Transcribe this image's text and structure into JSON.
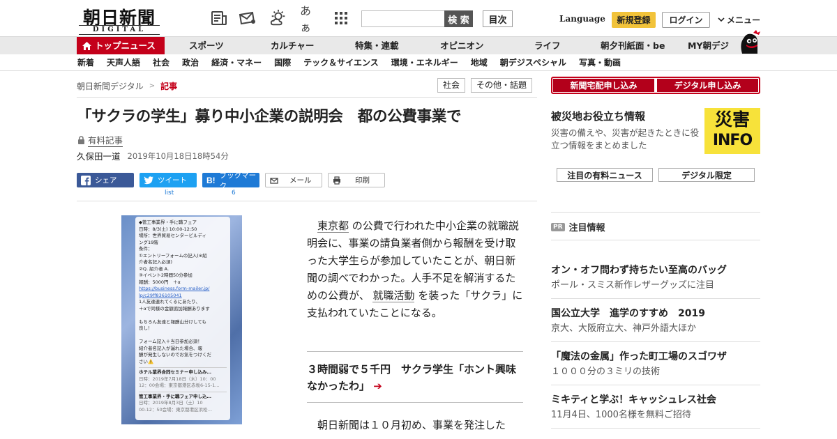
{
  "header": {
    "logo_main": "朝日新聞",
    "logo_sub": "DIGITAL",
    "search_placeholder": "",
    "search_label": "検 索",
    "toc_label": "目次",
    "language_label": "Language",
    "register_label": "新規登録",
    "login_label": "ログイン",
    "menu_label": "メニュー",
    "icons": [
      "paper-icon",
      "mail-icon",
      "weather-icon",
      "font-size-icon",
      "grid-icon"
    ],
    "font_icon_text": "あぁ"
  },
  "nav1": {
    "top_news": "トップニュース",
    "items": [
      "スポーツ",
      "カルチャー",
      "特集・連載",
      "オピニオン",
      "ライフ",
      "朝夕刊紙面・be",
      "MY朝デジ"
    ]
  },
  "nav2": {
    "items": [
      "新着",
      "天声人語",
      "社会",
      "政治",
      "経済・マネー",
      "国際",
      "テック＆サイエンス",
      "環境・エネルギー",
      "地域",
      "朝デジスペシャル",
      "写真・動画"
    ]
  },
  "breadcrumb": {
    "home": "朝日新聞デジタル",
    "sep": ">",
    "current": "記事"
  },
  "tags": [
    "社会",
    "その他・話題"
  ],
  "article": {
    "title": "「サクラの学生」募り中小企業の説明会　都の公費事業で",
    "paid_label": "有料記事",
    "author": "久保田一道",
    "date": "2019年10月18日18時54分",
    "share": {
      "facebook": "シェア",
      "twitter": "ツイート",
      "twitter_count": "list",
      "hatena": "ブックマーク",
      "hatena_count": "6",
      "mail": "メール",
      "print": "印刷"
    },
    "body_kw1": "東京都",
    "body_p1a": " の公費で行われた中小企業の就職説明会に、事業の請負業者側から報酬を受け取った大学生らが参加していたことが、朝日新聞の調べでわかった。人手不足を解消するための公費が、 ",
    "body_kw2": "就職活動",
    "body_p1b": " を装った「サクラ」に支払われていたことになる。",
    "related": "３時間弱で５千円　サクラ学生「ホント興味なかったわ」",
    "related_arrow": "➔",
    "body_p2": "　朝日新聞は１０月初め、事業を発注した"
  },
  "photo": {
    "lines": [
      "◆管工事業界・手に職フェア",
      "日時：8/3(土) 10:00-12:50",
      "場所：世界貿易センタービルディ",
      "ング19階",
      "条件：",
      "①エントリーフォームの記入(※紹",
      "介者名記入必須)",
      "②Q. 紹介者 A.",
      "③イベント2時間50分参加",
      "報酬：5000円　＋α"
    ],
    "link1": "https://business.form-mailer.jp/",
    "link2": "lp/c29ff836105041",
    "lines2": [
      "1人友達連れてくるにあたり、",
      "＋αで同様の金額追加報酬あります",
      "",
      "もちろん友達と報酬山分けしても",
      "良し！",
      "",
      "フォーム記入＋当日参加必須！",
      "紹介者名記入が漏れた場合、報",
      "酬が発生しないのでお気をつけくだ",
      "さい⚠️"
    ],
    "card1_title": "ホテル業界合同セミナー申し込み…",
    "card1_lines": [
      "日時：2019年7月18日（木）10：00",
      "12：00会場：東京都港区赤坂6-15-1…"
    ],
    "card2_title": "管工事業界・手に職フェア申し込…",
    "card2_lines": [
      "日時：2019年8月3日（土）10",
      "00-12：50会場：東京都港区浜松…"
    ]
  },
  "sidebar": {
    "subscribe_paper": "新聞宅配申し込み",
    "subscribe_digital": "デジタル申し込み",
    "disaster_title": "被災地お役立ち情報",
    "disaster_desc": "災害の備えや、災害が起きたときに役立つ情報をまとめました",
    "disaster_badge_kanji": "災害",
    "disaster_badge_en": "INFO",
    "tab_paid": "注目の有料ニュース",
    "tab_digital": "デジタル限定",
    "pr_badge": "PR",
    "pr_head": "注目情報",
    "pr_items": [
      {
        "title": "オン・オフ問わず持ちたい至高のバッグ",
        "desc": "ポール・スミス新作レザーグッズに注目"
      },
      {
        "title": "国公立大学　進学のすすめ　2019",
        "desc": "京大、大阪府立大、神戸外語大ほか"
      },
      {
        "title": "「魔法の金属」作った町工場のスゴワザ",
        "desc": "１０００分の３ミリの技術"
      },
      {
        "title": "ミキティと学ぶ！キャッシュレス社会",
        "desc": "11月4日、1000名様を無料ご招待"
      }
    ]
  },
  "colors": {
    "brand_red": "#c4001a",
    "accent_yellow": "#f2c33a",
    "facebook": "#3b5998",
    "twitter": "#1da1f2",
    "hatena": "#1e7ad6"
  }
}
